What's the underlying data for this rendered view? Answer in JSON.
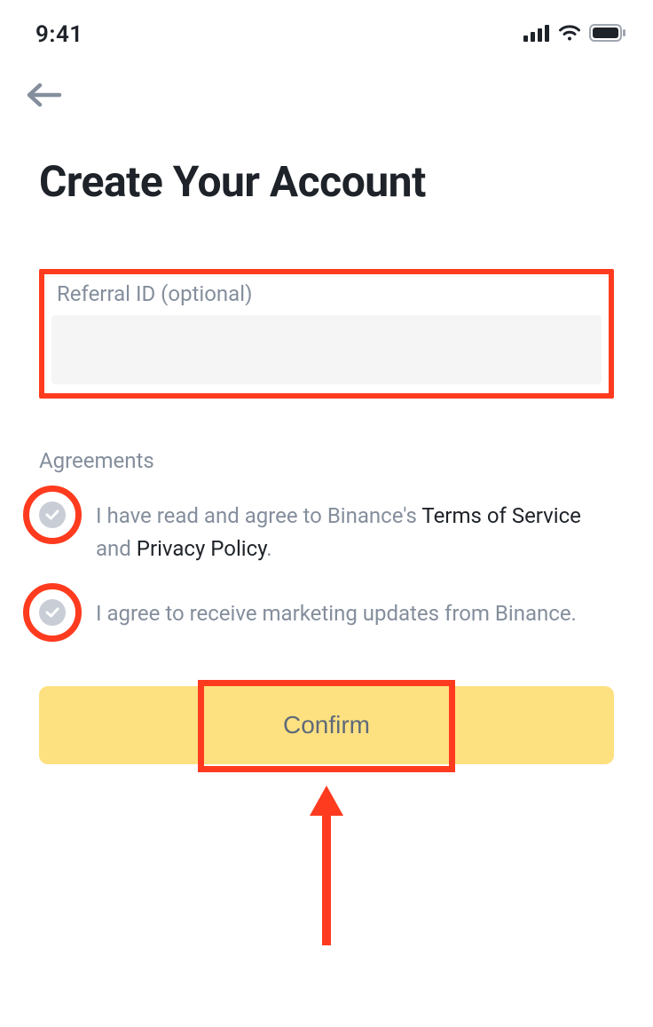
{
  "status": {
    "time": "9:41"
  },
  "nav": {
    "back_aria": "Back"
  },
  "header": {
    "title": "Create Your Account"
  },
  "referral": {
    "label": "Referral ID (optional)",
    "value": ""
  },
  "agreements": {
    "heading": "Agreements",
    "items": [
      {
        "prefix": "I have read and agree to Binance's ",
        "link1": "Terms of Service",
        "mid": " and ",
        "link2": "Privacy Policy",
        "suffix": "."
      },
      {
        "text": "I agree to receive marketing updates from Binance."
      }
    ]
  },
  "actions": {
    "confirm_label": "Confirm"
  }
}
